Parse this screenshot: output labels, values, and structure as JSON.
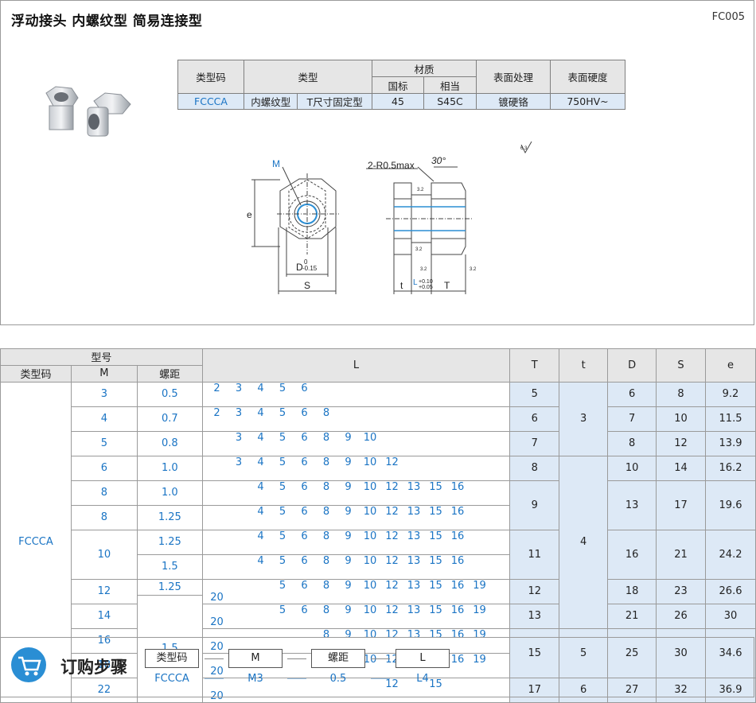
{
  "header": {
    "title": "浮动接头  内螺纹型  简易连接型",
    "code": "FC005"
  },
  "spec": {
    "h_type_code": "类型码",
    "h_type": "类型",
    "h_material": "材质",
    "h_mat_cn": "国标",
    "h_mat_jp": "相当",
    "h_surface": "表面处理",
    "h_hardness": "表面硬度",
    "type_code": "FCCCA",
    "type1": "内螺纹型",
    "type2": "T尺寸固定型",
    "mat_cn": "45",
    "mat_jp": "S45C",
    "surface": "镀硬铬",
    "hardness": "750HV~"
  },
  "drawing": {
    "m_label": "M",
    "e_label": "e",
    "d_label": "D",
    "d_tol_top": "0",
    "d_tol_bot": "-0.15",
    "s_label": "S",
    "r_label": "2-R0.5max",
    "angle": "30°",
    "t_label": "t",
    "l_label": "L",
    "l_tol_top": "+0.10",
    "l_tol_bot": "+0.05",
    "T_label": "T",
    "rough1": "3.2",
    "rough2": "3.2",
    "rough3": "3.2",
    "rough4": "3.2",
    "rough_main": "6.3"
  },
  "table": {
    "h_model": "型号",
    "h_type_code": "类型码",
    "h_m": "M",
    "h_pitch": "螺距",
    "h_l": "L",
    "h_T": "T",
    "h_t": "t",
    "h_D": "D",
    "h_S": "S",
    "h_e": "e",
    "type_code": "FCCCA",
    "rows": [
      {
        "m": "3",
        "p": "0.5",
        "l": [
          "2",
          "3",
          "4",
          "5",
          "6",
          "",
          "",
          "",
          "",
          "",
          "",
          "",
          "",
          ""
        ],
        "T": "5",
        "D": "6",
        "S": "8",
        "e": "9.2"
      },
      {
        "m": "4",
        "p": "0.7",
        "l": [
          "2",
          "3",
          "4",
          "5",
          "6",
          "8",
          "",
          "",
          "",
          "",
          "",
          "",
          "",
          ""
        ],
        "T": "6",
        "D": "7",
        "S": "10",
        "e": "11.5"
      },
      {
        "m": "5",
        "p": "0.8",
        "l": [
          "",
          "3",
          "4",
          "5",
          "6",
          "8",
          "9",
          "10",
          "",
          "",
          "",
          "",
          "",
          ""
        ],
        "T": "7",
        "D": "8",
        "S": "12",
        "e": "13.9"
      },
      {
        "m": "6",
        "p": "1.0",
        "l": [
          "",
          "3",
          "4",
          "5",
          "6",
          "8",
          "9",
          "10",
          "12",
          "",
          "",
          "",
          "",
          ""
        ],
        "T": "8",
        "D": "10",
        "S": "14",
        "e": "16.2"
      },
      {
        "m": "8",
        "p": "1.0",
        "l": [
          "",
          "",
          "4",
          "5",
          "6",
          "8",
          "9",
          "10",
          "12",
          "13",
          "15",
          "16",
          "",
          ""
        ]
      },
      {
        "m": "8",
        "p": "1.25",
        "l": [
          "",
          "",
          "4",
          "5",
          "6",
          "8",
          "9",
          "10",
          "12",
          "13",
          "15",
          "16",
          "",
          ""
        ]
      },
      {
        "m": "10",
        "p": "1.25",
        "l": [
          "",
          "",
          "4",
          "5",
          "6",
          "8",
          "9",
          "10",
          "12",
          "13",
          "15",
          "16",
          "",
          ""
        ]
      },
      {
        "p": "1.5",
        "l": [
          "",
          "",
          "4",
          "5",
          "6",
          "8",
          "9",
          "10",
          "12",
          "13",
          "15",
          "16",
          "",
          ""
        ]
      },
      {
        "m": "12",
        "p": "1.25",
        "l": [
          "",
          "",
          "",
          "5",
          "6",
          "8",
          "9",
          "10",
          "12",
          "13",
          "15",
          "16",
          "19",
          "20"
        ]
      },
      {
        "l": []
      },
      {
        "m": "14",
        "p": "1.5",
        "l": [
          "",
          "",
          "",
          "5",
          "6",
          "8",
          "9",
          "10",
          "12",
          "13",
          "15",
          "16",
          "19",
          "20"
        ],
        "T": "13",
        "D": "21",
        "S": "26",
        "e": "30"
      },
      {
        "m": "16",
        "l": [
          "",
          "",
          "",
          "",
          "",
          "8",
          "9",
          "10",
          "12",
          "13",
          "15",
          "16",
          "19",
          "20"
        ]
      },
      {
        "m": "18",
        "l": [
          "",
          "",
          "",
          "",
          "",
          "8",
          "9",
          "10",
          "12",
          "13",
          "15",
          "16",
          "19",
          "20"
        ]
      },
      {
        "m": "22",
        "l": [
          "",
          "",
          "",
          "",
          "",
          "",
          "",
          "",
          "12",
          "",
          "15",
          "",
          "",
          "20"
        ],
        "T": "17",
        "D": "27",
        "S": "32",
        "e": "36.9"
      }
    ],
    "merged": {
      "t1": "3",
      "t2": "4",
      "t3": "5",
      "t4": "6",
      "T89": "9",
      "D89": "13",
      "S89": "17",
      "e89": "19.6",
      "T1011": "11",
      "D1011": "16",
      "S1011": "21",
      "e1011": "24.2",
      "T12": "12",
      "D12": "18",
      "S12": "23",
      "e12": "26.6",
      "T1618": "15",
      "D1618": "25",
      "S1618": "30",
      "e1618": "34.6"
    }
  },
  "order": {
    "title": "订购步骤",
    "boxes": [
      "类型码",
      "M",
      "螺距",
      "L"
    ],
    "values": [
      "FCCCA",
      "M3",
      "0.5",
      "L4"
    ],
    "colors": {
      "accent": "#1a74c4",
      "header_bg": "#e6e6e6",
      "highlight_bg": "#dde9f6"
    }
  }
}
